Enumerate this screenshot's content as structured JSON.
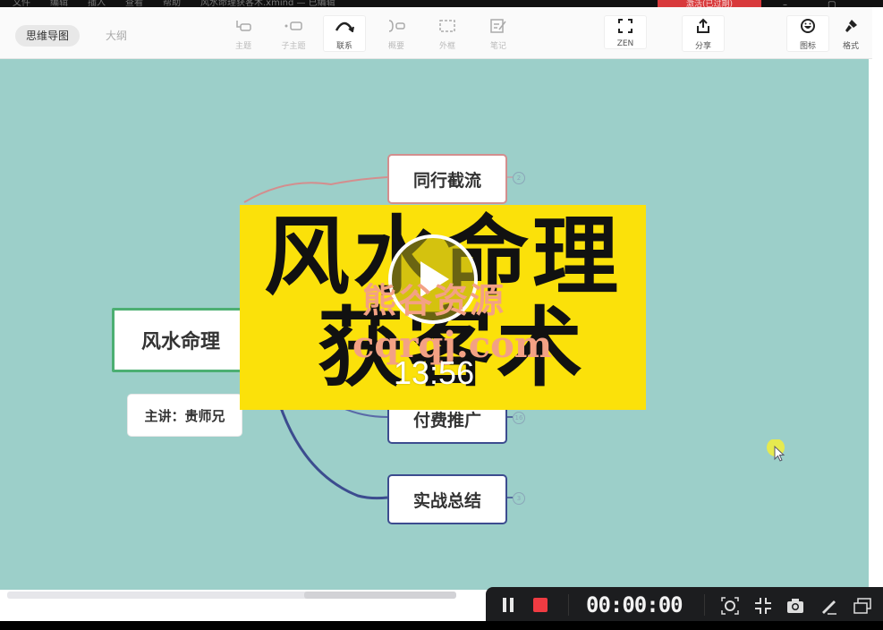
{
  "window": {
    "menu": [
      "文件",
      "编辑",
      "插入",
      "查看",
      "帮助"
    ],
    "title": "风水命理获客术.xmind — 已编辑",
    "badge": "激活(已过期)"
  },
  "toolbar": {
    "view_tabs": [
      {
        "label": "思维导图",
        "active": true
      },
      {
        "label": "大纲",
        "active": false
      }
    ],
    "tools": [
      {
        "label": "主题",
        "icon": "topic-icon"
      },
      {
        "label": "子主题",
        "icon": "subtopic-icon"
      },
      {
        "label": "联系",
        "icon": "relationship-icon"
      },
      {
        "label": "概要",
        "icon": "summary-icon"
      },
      {
        "label": "外框",
        "icon": "boundary-icon"
      },
      {
        "label": "笔记",
        "icon": "note-icon"
      },
      {
        "label": "ZEN",
        "icon": "zen-fullscreen-icon"
      },
      {
        "label": "分享",
        "icon": "share-icon"
      },
      {
        "label": "图标",
        "icon": "emoji-icon"
      },
      {
        "label": "格式",
        "icon": "format-brush-icon"
      }
    ]
  },
  "mindmap": {
    "central": "风水命理",
    "subtitle": "主讲：贵师兄",
    "branches": [
      {
        "label": "同行截流",
        "count": "2",
        "color": "#d38e8e"
      },
      {
        "label": "付费推广",
        "count": "16",
        "color": "#3c4c8f"
      },
      {
        "label": "实战总结",
        "count": "3",
        "color": "#3c4c8f"
      }
    ]
  },
  "video": {
    "title_line1": "风水命理",
    "title_line2": "获客术",
    "duration": "13:56",
    "watermark_cn": "熊谷资源",
    "watermark_url": "cqrqj.com",
    "background": "#fbe10a"
  },
  "recorder": {
    "elapsed": "00:00:00",
    "record_color": "#ef3b42",
    "tools": [
      "screenshot-region-icon",
      "shrink-icon",
      "camera-icon",
      "pen-icon",
      "window-icon"
    ]
  },
  "colors": {
    "canvas": "#9ccfc9",
    "central_border": "#4caf72"
  }
}
